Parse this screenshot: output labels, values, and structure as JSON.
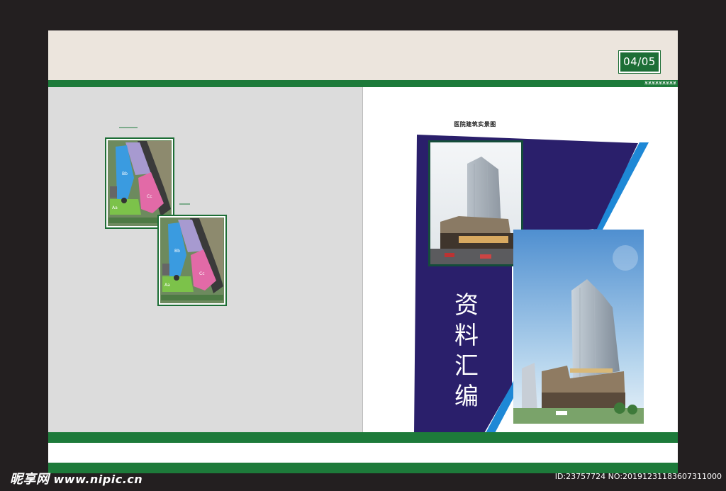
{
  "header": {
    "page_number": "04/05",
    "small_caption": "某某某某某某某某某"
  },
  "right_page": {
    "photo_caption": "医院建筑实景图",
    "title_chars": [
      "资",
      "料",
      "汇",
      "编"
    ]
  },
  "left_page": {
    "maps": [
      {
        "labels": [
          "Aa",
          "Bb",
          "Cc"
        ]
      },
      {
        "labels": [
          "Aa",
          "Bb",
          "Cc"
        ]
      }
    ]
  },
  "colors": {
    "green": "#1d7a3a",
    "navy": "#2a1f6b",
    "accent_blue": "#1e88d6",
    "beige": "#ece5dd",
    "left_page_grey": "#dcdcdc"
  },
  "watermark": {
    "logo": "昵享网",
    "url": "www.nipic.cn",
    "id_text": "ID:23757724 NO:20191231183607311000"
  }
}
